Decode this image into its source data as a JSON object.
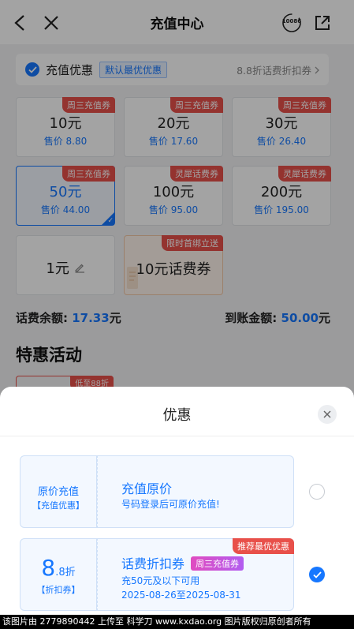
{
  "header": {
    "title": "充值中心",
    "service_badge": "10086"
  },
  "promo": {
    "label": "充值优惠",
    "tag": "默认最优优惠",
    "right_text": "8.8折话费折扣券"
  },
  "tiles": [
    {
      "amount": "10元",
      "price": "售价 8.80",
      "badge": "周三充值券"
    },
    {
      "amount": "20元",
      "price": "售价 17.60",
      "badge": "周三充值券"
    },
    {
      "amount": "30元",
      "price": "售价 26.40",
      "badge": "周三充值券"
    },
    {
      "amount": "50元",
      "price": "售价 44.00",
      "badge": "周三充值券"
    },
    {
      "amount": "100元",
      "price": "售价 95.00",
      "badge": "灵犀话费券"
    },
    {
      "amount": "200元",
      "price": "售价 195.00",
      "badge": "灵犀话费券"
    },
    {
      "amount": "1元"
    },
    {
      "amount": "10元话费券",
      "badge": "限时首绑立送"
    }
  ],
  "balance": {
    "label": "话费余额:",
    "value": "17.33",
    "unit": "元"
  },
  "arrival": {
    "label": "到账金额:",
    "value": "50.00",
    "unit": "元"
  },
  "special": {
    "title": "特惠活动",
    "tag": "低至88折"
  },
  "sheet": {
    "title": "优惠",
    "options": [
      {
        "left_title": "原价充值",
        "left_sub": "【充值优惠】",
        "title": "充值原价",
        "sub": "号码登录后可原价充值!"
      },
      {
        "left_big": "8",
        "left_small": ".8折",
        "left_sub": "【折扣券】",
        "title": "话费折扣券",
        "pill": "周三充值券",
        "sub1": "充50元及以下可用",
        "sub2": "2025-08-26至2025-08-31",
        "recommend": "推荐最优优惠"
      }
    ]
  },
  "footer": {
    "text": "该图片由 2779890442 上传至 科学刀 www.kxdao.org 图片版权归原创者所有"
  }
}
